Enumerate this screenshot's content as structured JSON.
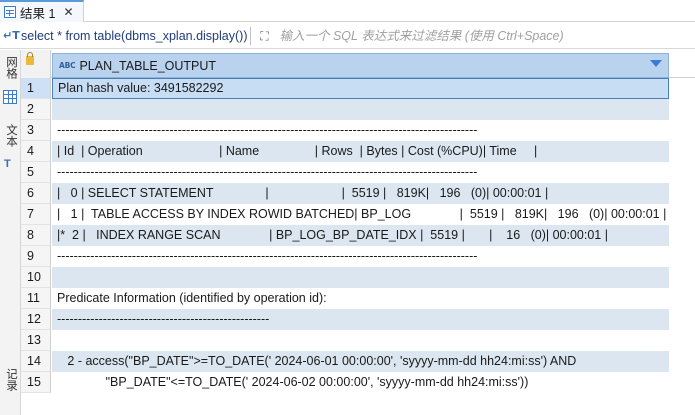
{
  "tab": {
    "label": "结果 1",
    "close": "✕"
  },
  "filter": {
    "sql": "select * from table(dbms_xplan.display())",
    "placeholder": "输入一个 SQL 表达式来过滤结果 (使用 Ctrl+Space)"
  },
  "side": {
    "grid_label": "网格",
    "text_label": "文本",
    "record_label": "记录"
  },
  "grid": {
    "type_badge": "ABC",
    "column": "PLAN_TABLE_OUTPUT",
    "rows": [
      {
        "n": "1",
        "text": "Plan hash value: 3491582292"
      },
      {
        "n": "2",
        "text": ""
      },
      {
        "n": "3",
        "text": "-----------------------------------------------------------------------------------------------------"
      },
      {
        "n": "4",
        "text": "| Id  | Operation                      | Name                | Rows  | Bytes | Cost (%CPU)| Time     |"
      },
      {
        "n": "5",
        "text": "-----------------------------------------------------------------------------------------------------"
      },
      {
        "n": "6",
        "text": "|   0 | SELECT STATEMENT               |                     |  5519 |   819K|   196   (0)| 00:00:01 |"
      },
      {
        "n": "7",
        "text": "|   1 |  TABLE ACCESS BY INDEX ROWID BATCHED| BP_LOG              |  5519 |   819K|   196   (0)| 00:00:01 |"
      },
      {
        "n": "8",
        "text": "|*  2 |   INDEX RANGE SCAN              | BP_LOG_BP_DATE_IDX |  5519 |       |    16   (0)| 00:00:01 |"
      },
      {
        "n": "9",
        "text": "-----------------------------------------------------------------------------------------------------"
      },
      {
        "n": "10",
        "text": ""
      },
      {
        "n": "11",
        "text": "Predicate Information (identified by operation id):"
      },
      {
        "n": "12",
        "text": "---------------------------------------------------"
      },
      {
        "n": "13",
        "text": ""
      },
      {
        "n": "14",
        "text": "   2 - access(\"BP_DATE\">=TO_DATE(' 2024-06-01 00:00:00', 'syyyy-mm-dd hh24:mi:ss') AND"
      },
      {
        "n": "15",
        "text": "              \"BP_DATE\"<=TO_DATE(' 2024-06-02 00:00:00', 'syyyy-mm-dd hh24:mi:ss'))"
      }
    ]
  }
}
